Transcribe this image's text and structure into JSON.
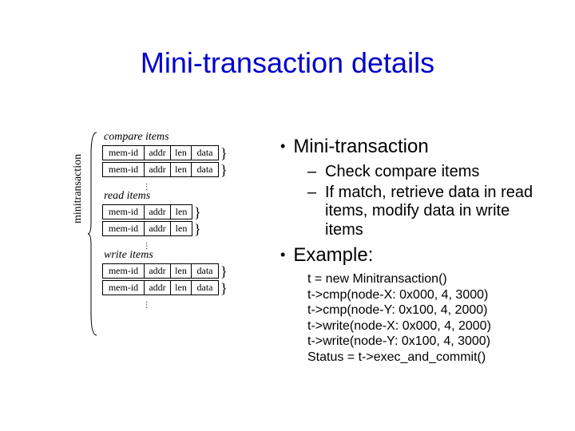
{
  "title": "Mini-transaction details",
  "diagram": {
    "vertical_label": "minitransaction",
    "groups": [
      {
        "label": "compare items",
        "rows": [
          {
            "cells": [
              "mem-id",
              "addr",
              "len",
              "data"
            ],
            "brace": true
          },
          {
            "cells": [
              "mem-id",
              "addr",
              "len",
              "data"
            ],
            "brace": true
          }
        ]
      },
      {
        "label": "read items",
        "rows": [
          {
            "cells": [
              "mem-id",
              "addr",
              "len"
            ],
            "brace": true
          },
          {
            "cells": [
              "mem-id",
              "addr",
              "len"
            ],
            "brace": true
          }
        ]
      },
      {
        "label": "write items",
        "rows": [
          {
            "cells": [
              "mem-id",
              "addr",
              "len",
              "data"
            ],
            "brace": true
          },
          {
            "cells": [
              "mem-id",
              "addr",
              "len",
              "data"
            ],
            "brace": true
          }
        ]
      }
    ],
    "cell_classes": {
      "mem-id": "c-mem",
      "addr": "c-addr",
      "len": "c-len",
      "data": "c-data"
    }
  },
  "bullets": {
    "l1a": "Mini-transaction",
    "subs": [
      "Check compare items",
      "If match, retrieve data in read items, modify data in write items"
    ],
    "l1b": "Example:",
    "code": [
      "t = new Minitransaction()",
      "t->cmp(node-X: 0x000, 4, 3000)",
      "t->cmp(node-Y: 0x100, 4, 2000)",
      "t->write(node-X: 0x000, 4, 2000)",
      "t->write(node-Y: 0x100, 4, 3000)",
      "Status = t->exec_and_commit()"
    ]
  }
}
